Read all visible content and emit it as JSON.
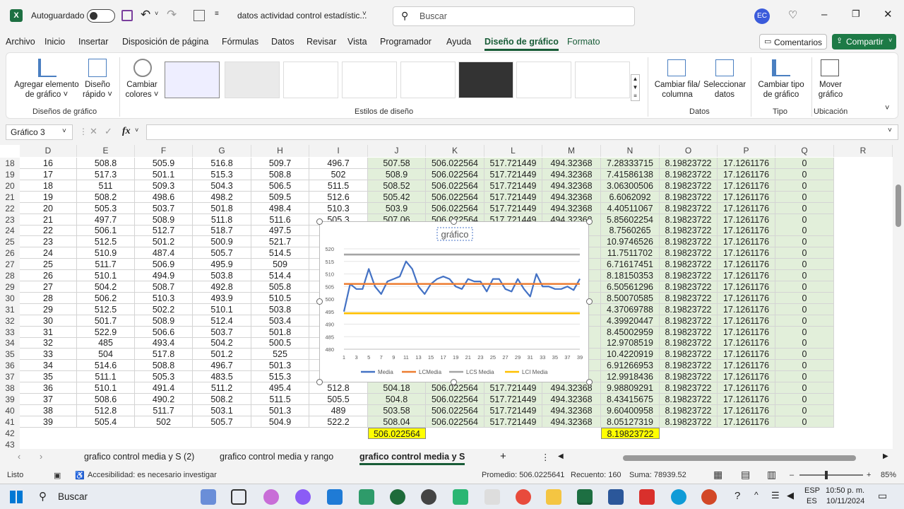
{
  "titlebar": {
    "autosave_label": "Autoguardado",
    "filename": "datos actividad control estadístic...",
    "search_placeholder": "Buscar",
    "user_initials": "EC"
  },
  "menu": [
    "Archivo",
    "Inicio",
    "Insertar",
    "Disposición de página",
    "Fórmulas",
    "Datos",
    "Revisar",
    "Vista",
    "Programador",
    "Ayuda",
    "Diseño de gráfico",
    "Formato"
  ],
  "menu_active": "Diseño de gráfico",
  "comments_label": "Comentarios",
  "share_label": "Compartir",
  "ribbon": {
    "add_element": [
      "Agregar elemento",
      "de gráfico ˅"
    ],
    "quick_layout": [
      "Diseño",
      "rápido ˅"
    ],
    "change_colors": [
      "Cambiar",
      "colores ˅"
    ],
    "group_layouts": "Diseños de gráfico",
    "group_styles": "Estilos de diseño",
    "switch_row": [
      "Cambiar fila/",
      "columna"
    ],
    "select_data": [
      "Seleccionar",
      "datos"
    ],
    "group_data": "Datos",
    "change_type": [
      "Cambiar tipo",
      "de gráfico"
    ],
    "group_type": "Tipo",
    "move_chart": [
      "Mover",
      "gráfico"
    ],
    "group_location": "Ubicación"
  },
  "namebox": "Gráfico 3",
  "fx_label": "fx",
  "columns": [
    "D",
    "E",
    "F",
    "G",
    "H",
    "I",
    "J",
    "K",
    "L",
    "M",
    "N",
    "O",
    "P",
    "Q",
    "R"
  ],
  "row_numbers": [
    18,
    19,
    20,
    21,
    22,
    23,
    24,
    25,
    26,
    27,
    28,
    29,
    30,
    31,
    32,
    33,
    34,
    35,
    36,
    37,
    38,
    39,
    40,
    41,
    42,
    43
  ],
  "rows": [
    [
      "16",
      "508.8",
      "505.9",
      "516.8",
      "509.7",
      "496.7",
      "507.58",
      "506.022564",
      "517.721449",
      "494.32368",
      "7.28333715",
      "8.19823722",
      "17.1261176",
      "0"
    ],
    [
      "17",
      "517.3",
      "501.1",
      "515.3",
      "508.8",
      "502",
      "508.9",
      "506.022564",
      "517.721449",
      "494.32368",
      "7.41586138",
      "8.19823722",
      "17.1261176",
      "0"
    ],
    [
      "18",
      "511",
      "509.3",
      "504.3",
      "506.5",
      "511.5",
      "508.52",
      "506.022564",
      "517.721449",
      "494.32368",
      "3.06300506",
      "8.19823722",
      "17.1261176",
      "0"
    ],
    [
      "19",
      "508.2",
      "498.6",
      "498.2",
      "509.5",
      "512.6",
      "505.42",
      "506.022564",
      "517.721449",
      "494.32368",
      "6.6062092",
      "8.19823722",
      "17.1261176",
      "0"
    ],
    [
      "20",
      "505.3",
      "503.7",
      "501.8",
      "498.4",
      "510.3",
      "503.9",
      "506.022564",
      "517.721449",
      "494.32368",
      "4.40511067",
      "8.19823722",
      "17.1261176",
      "0"
    ],
    [
      "21",
      "497.7",
      "508.9",
      "511.8",
      "511.6",
      "505.3",
      "507.06",
      "506.022564",
      "517.721449",
      "494.32368",
      "5.85602254",
      "8.19823722",
      "17.1261176",
      "0"
    ],
    [
      "22",
      "506.1",
      "512.7",
      "518.7",
      "497.5",
      "",
      "",
      "",
      "",
      "",
      "8.7560265",
      "8.19823722",
      "17.1261176",
      "0"
    ],
    [
      "23",
      "512.5",
      "501.2",
      "500.9",
      "521.7",
      "",
      "",
      "",
      "",
      "",
      "10.9746526",
      "8.19823722",
      "17.1261176",
      "0"
    ],
    [
      "24",
      "510.9",
      "487.4",
      "505.7",
      "514.5",
      "",
      "",
      "",
      "",
      "",
      "11.7511702",
      "8.19823722",
      "17.1261176",
      "0"
    ],
    [
      "25",
      "511.7",
      "506.9",
      "495.9",
      "509",
      "",
      "",
      "",
      "",
      "",
      "6.71617451",
      "8.19823722",
      "17.1261176",
      "0"
    ],
    [
      "26",
      "510.1",
      "494.9",
      "503.8",
      "514.4",
      "",
      "",
      "",
      "",
      "",
      "8.18150353",
      "8.19823722",
      "17.1261176",
      "0"
    ],
    [
      "27",
      "504.2",
      "508.7",
      "492.8",
      "505.8",
      "",
      "",
      "",
      "",
      "",
      "6.50561296",
      "8.19823722",
      "17.1261176",
      "0"
    ],
    [
      "28",
      "506.2",
      "510.3",
      "493.9",
      "510.5",
      "",
      "",
      "",
      "",
      "",
      "8.50070585",
      "8.19823722",
      "17.1261176",
      "0"
    ],
    [
      "29",
      "512.5",
      "502.2",
      "510.1",
      "503.8",
      "",
      "",
      "",
      "",
      "",
      "4.37069788",
      "8.19823722",
      "17.1261176",
      "0"
    ],
    [
      "30",
      "501.7",
      "508.9",
      "512.4",
      "503.4",
      "",
      "",
      "",
      "",
      "",
      "4.39920447",
      "8.19823722",
      "17.1261176",
      "0"
    ],
    [
      "31",
      "522.9",
      "506.6",
      "503.7",
      "501.8",
      "",
      "",
      "",
      "",
      "",
      "8.45002959",
      "8.19823722",
      "17.1261176",
      "0"
    ],
    [
      "32",
      "485",
      "493.4",
      "504.2",
      "500.5",
      "",
      "",
      "",
      "",
      "",
      "12.9708519",
      "8.19823722",
      "17.1261176",
      "0"
    ],
    [
      "33",
      "504",
      "517.8",
      "501.2",
      "525",
      "",
      "",
      "",
      "",
      "",
      "10.4220919",
      "8.19823722",
      "17.1261176",
      "0"
    ],
    [
      "34",
      "514.6",
      "508.8",
      "496.7",
      "501.3",
      "",
      "",
      "",
      "",
      "",
      "6.91266953",
      "8.19823722",
      "17.1261176",
      "0"
    ],
    [
      "35",
      "511.1",
      "505.3",
      "483.5",
      "515.3",
      "",
      "",
      "",
      "",
      "",
      "12.9918436",
      "8.19823722",
      "17.1261176",
      "0"
    ],
    [
      "36",
      "510.1",
      "491.4",
      "511.2",
      "495.4",
      "512.8",
      "504.18",
      "506.022564",
      "517.721449",
      "494.32368",
      "9.98809291",
      "8.19823722",
      "17.1261176",
      "0"
    ],
    [
      "37",
      "508.6",
      "490.2",
      "508.2",
      "511.5",
      "505.5",
      "504.8",
      "506.022564",
      "517.721449",
      "494.32368",
      "8.43415675",
      "8.19823722",
      "17.1261176",
      "0"
    ],
    [
      "38",
      "512.8",
      "511.7",
      "503.1",
      "501.3",
      "489",
      "503.58",
      "506.022564",
      "517.721449",
      "494.32368",
      "9.60400958",
      "8.19823722",
      "17.1261176",
      "0"
    ],
    [
      "39",
      "505.4",
      "502",
      "505.7",
      "504.9",
      "522.2",
      "508.04",
      "506.022564",
      "517.721449",
      "494.32368",
      "8.05127319",
      "8.19823722",
      "17.1261176",
      "0"
    ]
  ],
  "totals": {
    "j": "506.022564",
    "n": "8.19823722"
  },
  "chart_data": {
    "type": "line",
    "title": "gráfico",
    "ylim": [
      480,
      520
    ],
    "yticks": [
      480,
      485,
      490,
      495,
      500,
      505,
      510,
      515,
      520
    ],
    "xticks": [
      1,
      3,
      5,
      7,
      9,
      11,
      13,
      15,
      17,
      19,
      21,
      23,
      25,
      27,
      29,
      31,
      33,
      35,
      37,
      39
    ],
    "x": [
      1,
      2,
      3,
      4,
      5,
      6,
      7,
      8,
      9,
      10,
      11,
      12,
      13,
      14,
      15,
      16,
      17,
      18,
      19,
      20,
      21,
      22,
      23,
      24,
      25,
      26,
      27,
      28,
      29,
      30,
      31,
      32,
      33,
      34,
      35,
      36,
      37,
      38,
      39
    ],
    "series": [
      {
        "name": "Media",
        "color": "#4472c4",
        "values": [
          495,
          506,
          504,
          504,
          512,
          505,
          502,
          507,
          508,
          509,
          515,
          512,
          505,
          502,
          506,
          508,
          509,
          508,
          505,
          504,
          508,
          507,
          507,
          503,
          508,
          508,
          504,
          503,
          508,
          504,
          501,
          510,
          505,
          505,
          504,
          504,
          505,
          503.58,
          508.04
        ]
      },
      {
        "name": "LCMedia",
        "color": "#ed7d31",
        "values": "constant:506.022564"
      },
      {
        "name": "LCS Media",
        "color": "#a5a5a5",
        "values": "constant:517.721449"
      },
      {
        "name": "LCI Media",
        "color": "#ffc000",
        "values": "constant:494.32368"
      }
    ],
    "grid": true,
    "legend": "bottom"
  },
  "sheet_tabs": [
    "grafico control media y S (2)",
    "grafico control media y rango",
    "grafico control media y S"
  ],
  "sheet_tab_active": 2,
  "status": {
    "ready": "Listo",
    "accessibility": "Accesibilidad: es necesario investigar",
    "average": "Promedio: 506.0225641",
    "count": "Recuento: 160",
    "sum": "Suma: 78939.52",
    "zoom": "85%"
  },
  "taskbar": {
    "search": "Buscar",
    "lang1": "ESP",
    "lang2": "ES",
    "time": "10:50 p. m.",
    "date": "10/11/2024"
  }
}
